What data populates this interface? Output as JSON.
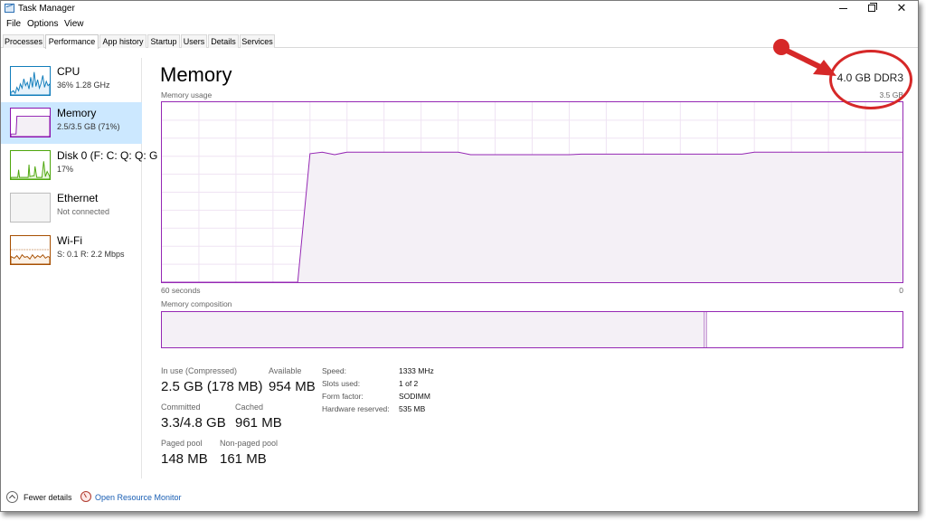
{
  "window": {
    "title": "Task Manager"
  },
  "menu": [
    "File",
    "Options",
    "View"
  ],
  "tabs": [
    "Processes",
    "Performance",
    "App history",
    "Startup",
    "Users",
    "Details",
    "Services"
  ],
  "active_tab": "Performance",
  "sidebar": [
    {
      "title": "CPU",
      "sub": "36% 1.28 GHz",
      "color": "#117dbb"
    },
    {
      "title": "Memory",
      "sub": "2.5/3.5 GB (71%)",
      "color": "#8b12ae"
    },
    {
      "title": "Disk 0 (F: C: Q: Q: G",
      "sub": "17%",
      "color": "#4da60c"
    },
    {
      "title": "Ethernet",
      "sub": "Not connected",
      "color": "#a74f01"
    },
    {
      "title": "Wi-Fi",
      "sub": "S: 0.1 R: 2.2 Mbps",
      "color": "#a74f01"
    }
  ],
  "memory": {
    "heading": "Memory",
    "spec": "4.0 GB DDR3",
    "usage_label": "Memory usage",
    "usage_max": "3.5 GB",
    "time_left": "60 seconds",
    "time_right": "0",
    "composition_label": "Memory composition",
    "usage_history_gb": [
      0,
      0,
      0,
      0,
      0,
      0,
      0,
      0,
      0,
      0,
      0,
      0,
      2.5,
      2.53,
      2.48,
      2.53,
      2.53,
      2.53,
      2.53,
      2.53,
      2.53,
      2.53,
      2.53,
      2.53,
      2.53,
      2.48,
      2.48,
      2.48,
      2.48,
      2.48,
      2.48,
      2.48,
      2.48,
      2.48,
      2.49,
      2.49,
      2.49,
      2.49,
      2.49,
      2.49,
      2.49,
      2.49,
      2.49,
      2.49,
      2.49,
      2.49,
      2.49,
      2.49,
      2.53,
      2.53,
      2.53,
      2.53,
      2.53,
      2.53,
      2.53,
      2.53,
      2.53,
      2.53,
      2.53,
      2.53,
      2.53
    ],
    "stats": {
      "in_use_label": "In use (Compressed)",
      "in_use_value": "2.5 GB (178 MB)",
      "available_label": "Available",
      "available_value": "954 MB",
      "committed_label": "Committed",
      "committed_value": "3.3/4.8 GB",
      "cached_label": "Cached",
      "cached_value": "961 MB",
      "paged_label": "Paged pool",
      "paged_value": "148 MB",
      "nonpaged_label": "Non-paged pool",
      "nonpaged_value": "161 MB"
    },
    "info": [
      {
        "label": "Speed:",
        "value": "1333 MHz"
      },
      {
        "label": "Slots used:",
        "value": "1 of 2"
      },
      {
        "label": "Form factor:",
        "value": "SODIMM"
      },
      {
        "label": "Hardware reserved:",
        "value": "535 MB"
      }
    ]
  },
  "footer": {
    "fewer_details": "Fewer details",
    "resource_monitor": "Open Resource Monitor"
  },
  "colors": {
    "accent": "#9528b4",
    "fill": "#f4f0f6",
    "grid": "#efe3f3",
    "annotation": "#d62828",
    "link": "#1a5fb4",
    "selected": "#cce8ff"
  }
}
